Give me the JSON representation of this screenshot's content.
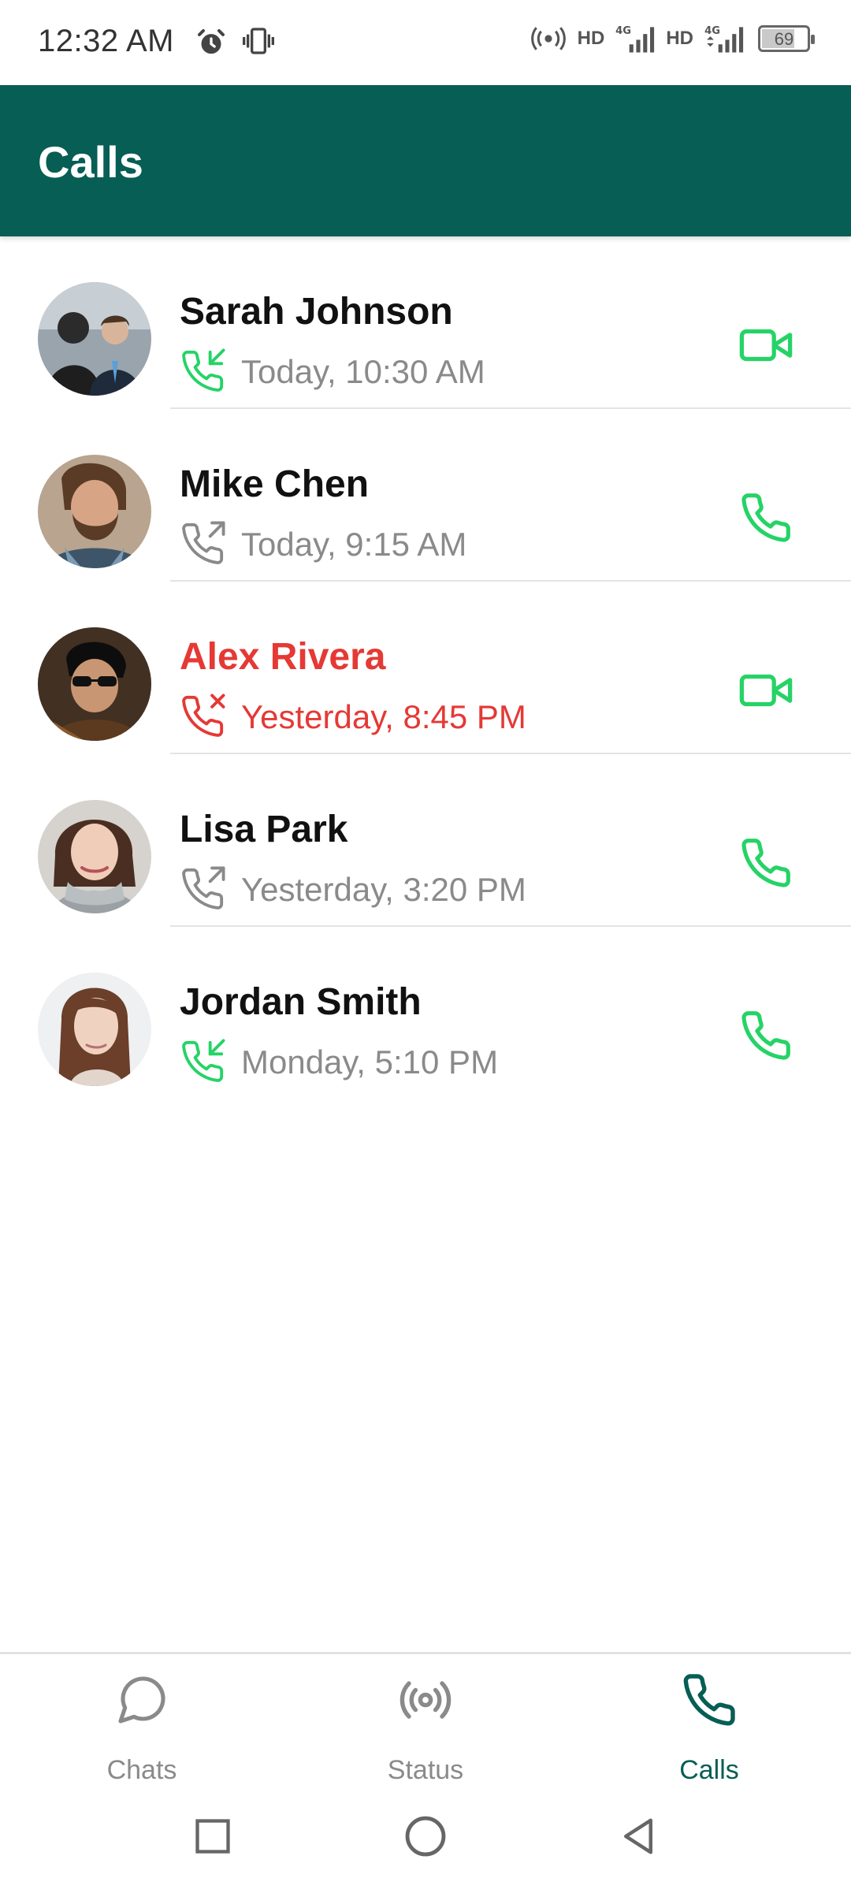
{
  "status_bar": {
    "time": "12:32 AM",
    "hd1": "HD",
    "hd2": "HD",
    "battery": "69",
    "battery_level": 0.69
  },
  "header": {
    "title": "Calls"
  },
  "colors": {
    "header": "#075E54",
    "accent_green": "#25D366",
    "missed_red": "#E53935",
    "secondary_text": "#8a8a8a"
  },
  "calls": [
    {
      "name": "Sarah Johnson",
      "time": "Today, 10:30 AM",
      "direction": "incoming",
      "type": "video",
      "missed": false
    },
    {
      "name": "Mike Chen",
      "time": "Today, 9:15 AM",
      "direction": "outgoing",
      "type": "voice",
      "missed": false
    },
    {
      "name": "Alex Rivera",
      "time": "Yesterday, 8:45 PM",
      "direction": "missed",
      "type": "video",
      "missed": true
    },
    {
      "name": "Lisa Park",
      "time": "Yesterday, 3:20 PM",
      "direction": "outgoing",
      "type": "voice",
      "missed": false
    },
    {
      "name": "Jordan Smith",
      "time": "Monday, 5:10 PM",
      "direction": "incoming",
      "type": "voice",
      "missed": false
    }
  ],
  "nav": {
    "chats": "Chats",
    "status": "Status",
    "calls": "Calls",
    "active": "calls"
  }
}
